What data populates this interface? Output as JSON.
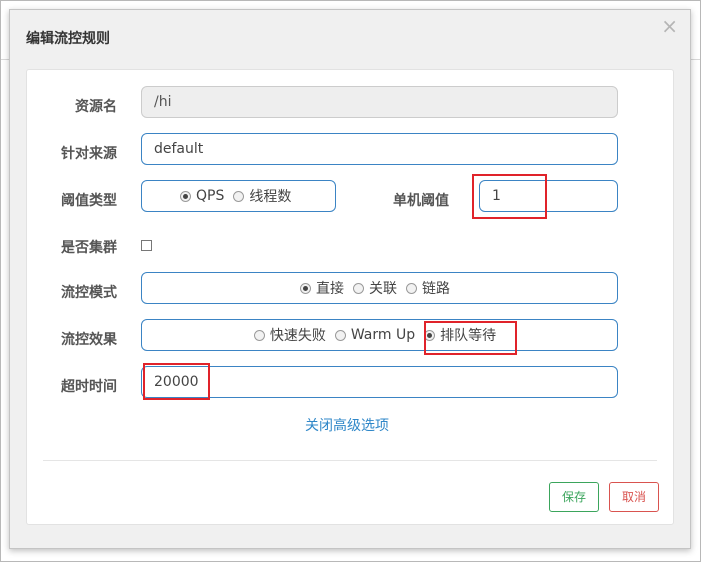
{
  "dialog": {
    "title": "编辑流控规则",
    "close_glyph": "×"
  },
  "form": {
    "resource": {
      "label": "资源名",
      "value": "/hi"
    },
    "source": {
      "label": "针对来源",
      "value": "default"
    },
    "threshold_type": {
      "label": "阈值类型",
      "options": [
        "QPS",
        "线程数"
      ],
      "selected": "QPS"
    },
    "single_threshold": {
      "label": "单机阈值",
      "value": "1"
    },
    "cluster": {
      "label": "是否集群",
      "checked": false
    },
    "flow_mode": {
      "label": "流控模式",
      "options": [
        "直接",
        "关联",
        "链路"
      ],
      "selected": "直接"
    },
    "flow_effect": {
      "label": "流控效果",
      "options": [
        "快速失败",
        "Warm Up",
        "排队等待"
      ],
      "selected": "排队等待"
    },
    "timeout": {
      "label": "超时时间",
      "value": "20000"
    },
    "advanced_link": "关闭高级选项"
  },
  "footer": {
    "save_label": "保存",
    "cancel_label": "取消"
  },
  "colors": {
    "input_border": "#3b84c4",
    "highlight": "#e0232a",
    "save": "#3ba55c",
    "cancel": "#d9534f",
    "link": "#2f87c8"
  }
}
